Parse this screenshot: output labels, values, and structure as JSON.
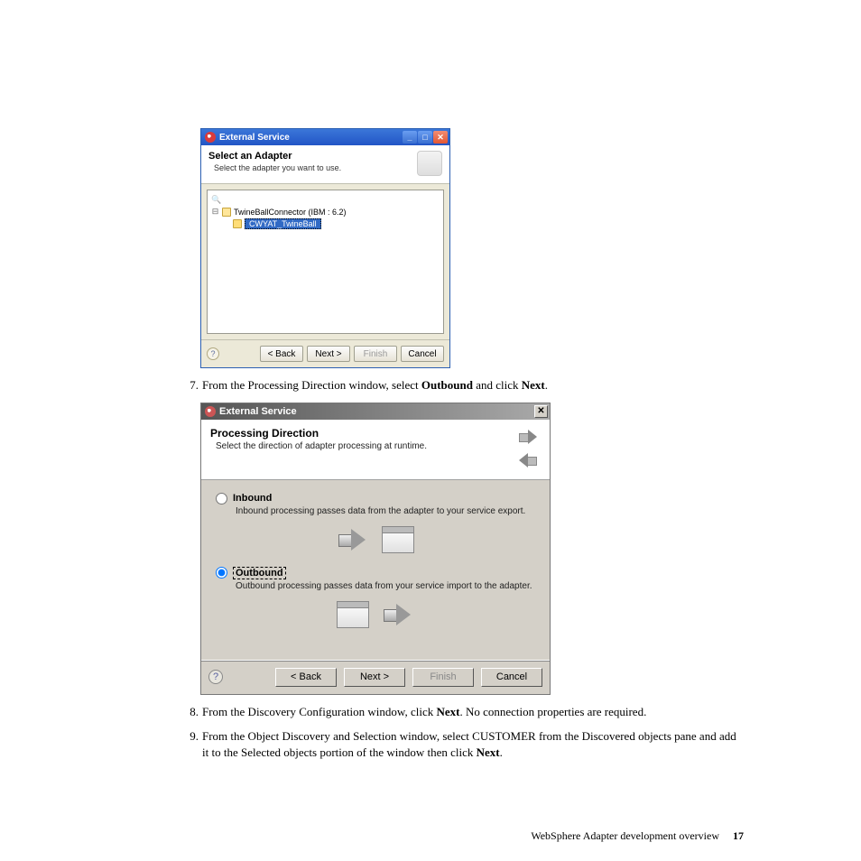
{
  "win1": {
    "title": "External Service",
    "header_title": "Select an Adapter",
    "header_sub": "Select the adapter you want to use.",
    "tree": {
      "parent": "TwineBallConnector (IBM : 6.2)",
      "selected": "CWYAT_TwineBall"
    },
    "buttons": {
      "back": "< Back",
      "next": "Next >",
      "finish": "Finish",
      "cancel": "Cancel"
    }
  },
  "step7": {
    "num": "7.",
    "text_a": "From the Processing Direction window, select ",
    "bold_a": "Outbound",
    "text_b": " and click ",
    "bold_b": "Next",
    "text_c": "."
  },
  "win2": {
    "title": "External Service",
    "header_title": "Processing Direction",
    "header_sub": "Select the direction of adapter processing at runtime.",
    "inbound": {
      "label": "Inbound",
      "desc": "Inbound processing passes data from the adapter to your service export."
    },
    "outbound": {
      "label": "Outbound",
      "desc": "Outbound processing passes data from your service import to the adapter."
    },
    "buttons": {
      "back": "< Back",
      "next": "Next >",
      "finish": "Finish",
      "cancel": "Cancel"
    }
  },
  "step8": {
    "num": "8.",
    "text_a": "From the Discovery Configuration window, click ",
    "bold_a": "Next",
    "text_b": ". No connection properties are required."
  },
  "step9": {
    "num": "9.",
    "text_a": "From the Object Discovery and Selection window, select CUSTOMER from the Discovered objects pane and add it to the Selected objects portion of the window then click ",
    "bold_a": "Next",
    "text_b": "."
  },
  "footer": {
    "section": "WebSphere Adapter development overview",
    "page": "17"
  }
}
